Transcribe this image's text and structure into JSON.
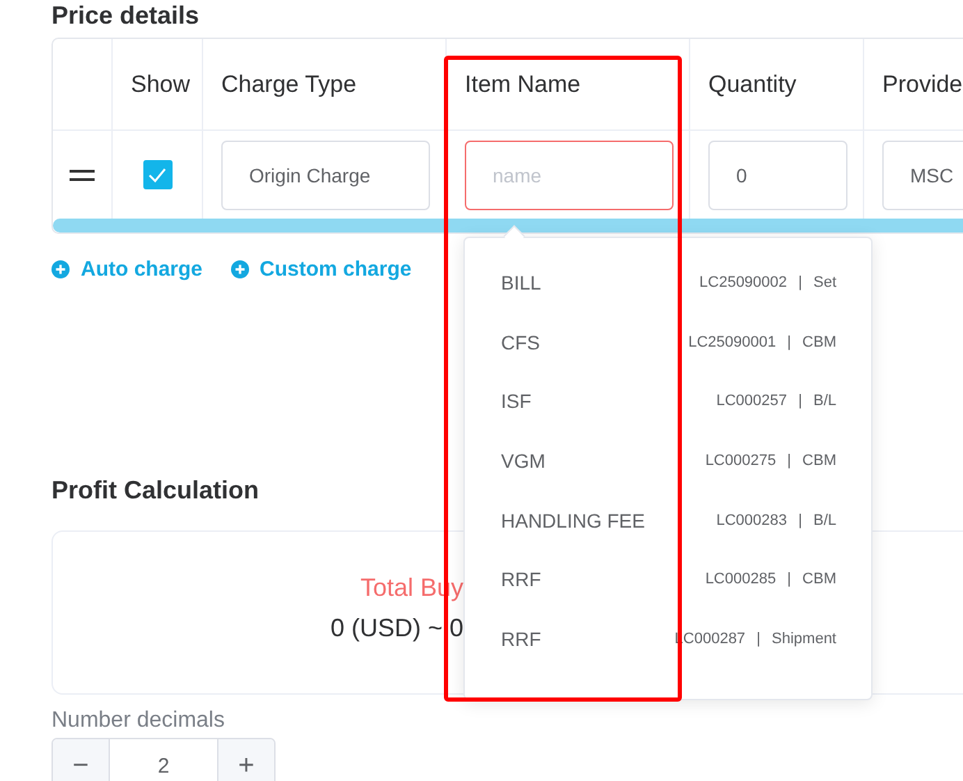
{
  "price_details": {
    "title": "Price details",
    "columns": [
      "Show",
      "Charge Type",
      "Item Name",
      "Quantity",
      "Provide"
    ],
    "row": {
      "checked": true,
      "charge_type": "Origin Charge",
      "item_name": {
        "placeholder": "name"
      },
      "quantity": "0",
      "provider": "MSC"
    },
    "actions": [
      "Auto charge",
      "Custom charge"
    ]
  },
  "item_dropdown": [
    {
      "name": "BILL",
      "detail": "LC25090002 | Set"
    },
    {
      "name": "CFS",
      "detail": "LC25090001 | CBM"
    },
    {
      "name": "ISF",
      "detail": "LC000257 | B/L"
    },
    {
      "name": "VGM",
      "detail": "LC000275 | CBM"
    },
    {
      "name": "HANDLING FEE",
      "detail": "LC000283 | B/L"
    },
    {
      "name": "RRF",
      "detail": "LC000285 | CBM"
    },
    {
      "name": "RRF",
      "detail": "LC000287 | Shipment"
    }
  ],
  "profit": {
    "title": "Profit Calculation",
    "total_label": "Total Buy",
    "total_value": "0 (USD) ~ 0"
  },
  "decimals": {
    "label": "Number decimals",
    "minus": "−",
    "value": "2",
    "plus": "+"
  }
}
